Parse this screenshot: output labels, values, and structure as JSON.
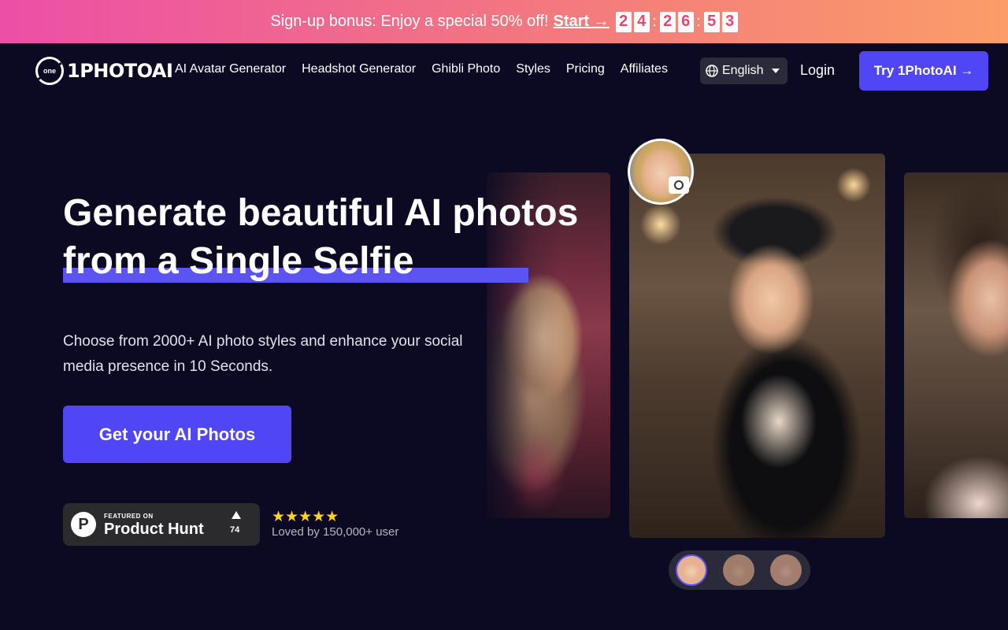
{
  "promo": {
    "text": "Sign-up bonus: Enjoy a special 50% off!",
    "start_label": "Start →",
    "countdown": [
      "2",
      "4",
      "2",
      "6",
      "5",
      "3"
    ]
  },
  "nav": {
    "logo_mark": "one",
    "logo_text": "1PHOTOAI",
    "links": [
      "AI Avatar Generator",
      "Headshot Generator",
      "Ghibli Photo",
      "Styles",
      "Pricing",
      "Affiliates"
    ],
    "language": "English",
    "login": "Login",
    "try_button": "Try 1PhotoAI →"
  },
  "hero": {
    "title_line1": "Generate beautiful AI photos",
    "title_line2": "from a Single Selfie",
    "subtitle": "Choose from 2000+ AI photo styles and enhance your social media presence in 10 Seconds.",
    "cta": "Get your AI Photos",
    "product_hunt": {
      "featured": "FEATURED ON",
      "name": "Product Hunt",
      "logo_letter": "P",
      "count": "74"
    },
    "rating_stars": 5,
    "stars_text": "★★★★★",
    "loved": "Loved by 150,000+ user"
  },
  "colors": {
    "background": "#0b0a22",
    "accent": "#5046f5",
    "star": "#ffd21f"
  }
}
